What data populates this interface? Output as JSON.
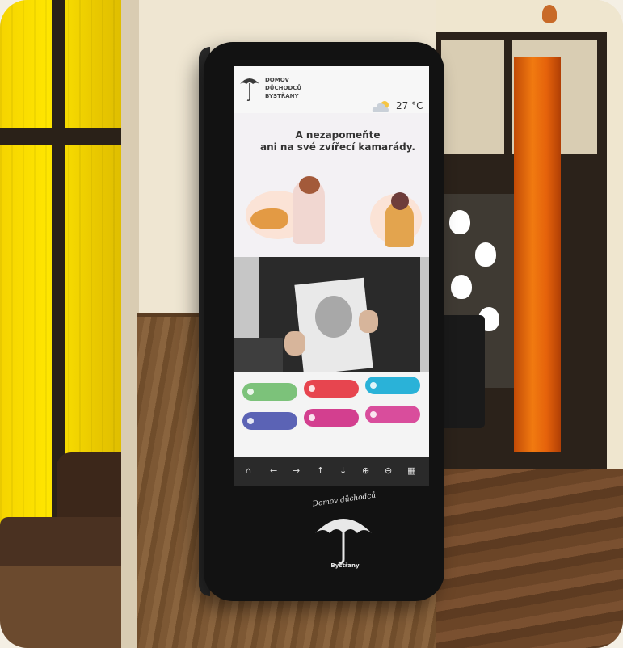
{
  "kiosk": {
    "header": {
      "org_name_lines": [
        "DOMOV",
        "DŮCHODCŮ",
        "BYSTŘANY"
      ],
      "weather_icon": "cloud-sun-icon",
      "temperature": "27 °C"
    },
    "promo": {
      "title_line1": "A nezapomeňte",
      "title_line2": "ani na své zvířecí kamarády."
    },
    "tiles": [
      {
        "icon": "tile-icon",
        "color": "#7cc27a"
      },
      {
        "icon": "tile-icon",
        "color": "#e7454f"
      },
      {
        "icon": "tile-icon",
        "color": "#2ab2d8"
      },
      {
        "icon": "tile-icon",
        "color": "#5b63b5"
      },
      {
        "icon": "tile-icon",
        "color": "#d33f8f"
      },
      {
        "icon": "tile-icon",
        "color": "#d94d9c"
      }
    ],
    "toolbar": {
      "home": "⌂",
      "back": "←",
      "forward": "→",
      "up": "↑",
      "down": "↓",
      "zoom_in": "⊕",
      "zoom_out": "⊖",
      "keyboard": "▦"
    },
    "bezel": {
      "script_text": "Domov důchodců",
      "town_text": "Bystřany"
    }
  }
}
